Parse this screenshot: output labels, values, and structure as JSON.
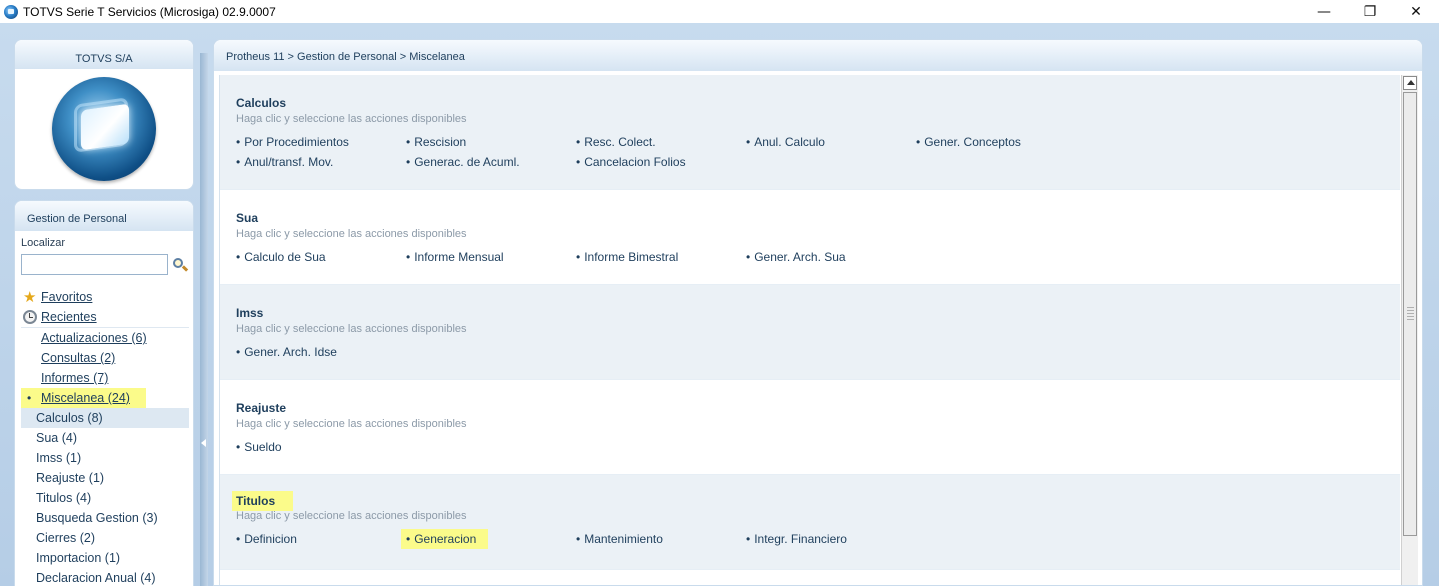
{
  "window": {
    "title": "TOTVS Serie T Servicios (Microsiga) 02.9.0007",
    "minimize": "—",
    "restore": "❐",
    "close": "✕"
  },
  "logo_panel": {
    "company": "TOTVS S/A"
  },
  "nav_panel": {
    "header": "Gestion de Personal",
    "search_label": "Localizar",
    "search_value": "",
    "favorites": "Favoritos",
    "recents": "Recientes",
    "items": [
      {
        "label": "Actualizaciones (6)"
      },
      {
        "label": "Consultas (2)"
      },
      {
        "label": "Informes (7)"
      }
    ],
    "active": {
      "label": "Miscelanea (24)"
    },
    "sub_items": [
      {
        "label": "Calculos (8)"
      },
      {
        "label": "Sua (4)"
      },
      {
        "label": "Imss (1)"
      },
      {
        "label": "Reajuste (1)"
      },
      {
        "label": "Titulos (4)"
      },
      {
        "label": "Busqueda Gestion (3)"
      },
      {
        "label": "Cierres (2)"
      },
      {
        "label": "Importacion (1)"
      },
      {
        "label": "Declaracion Anual (4)"
      }
    ]
  },
  "breadcrumb": "Protheus 11 > Gestion de Personal > Miscelanea",
  "bullet": "•",
  "sections": [
    {
      "title": "Calculos",
      "subtitle": "Haga clic y seleccione las acciones disponibles",
      "actions_row1": [
        "Por Procedimientos",
        "Rescision",
        "Resc. Colect.",
        "Anul. Calculo",
        "Gener. Conceptos"
      ],
      "actions_row2": [
        "Anul/transf. Mov.",
        "Generac. de Acuml.",
        "Cancelacion Folios"
      ]
    },
    {
      "title": "Sua",
      "subtitle": "Haga clic y seleccione las acciones disponibles",
      "actions_row1": [
        "Calculo de Sua",
        "Informe Mensual",
        "Informe Bimestral",
        "Gener. Arch. Sua"
      ]
    },
    {
      "title": "Imss",
      "subtitle": "Haga clic y seleccione las acciones disponibles",
      "actions_row1": [
        "Gener. Arch. Idse"
      ]
    },
    {
      "title": "Reajuste",
      "subtitle": "Haga clic y seleccione las acciones disponibles",
      "actions_row1": [
        "Sueldo"
      ]
    },
    {
      "title": "Titulos",
      "subtitle": "Haga clic y seleccione las acciones disponibles",
      "actions_row1": [
        "Definicion",
        "Generacion",
        "Mantenimiento",
        "Integr. Financiero"
      ]
    }
  ],
  "highlight_color": "#fbfb8a",
  "accent_color": "#1e3e5c"
}
